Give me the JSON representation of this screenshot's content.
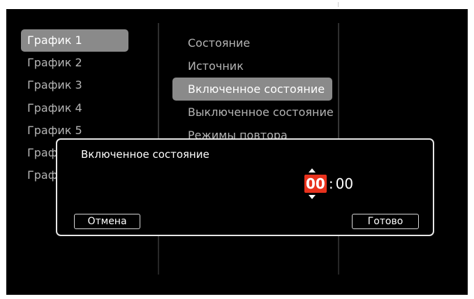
{
  "schedules": [
    {
      "label": "График 1",
      "selected": true
    },
    {
      "label": "График 2",
      "selected": false
    },
    {
      "label": "График 3",
      "selected": false
    },
    {
      "label": "График 4",
      "selected": false
    },
    {
      "label": "График 5",
      "selected": false
    },
    {
      "label": "Граф",
      "selected": false
    },
    {
      "label": "Граф",
      "selected": false
    }
  ],
  "settings": [
    {
      "label": "Состояние",
      "selected": false
    },
    {
      "label": "Источник",
      "selected": false
    },
    {
      "label": "Включенное состояние",
      "selected": true
    },
    {
      "label": "Выключенное состояние",
      "selected": false
    },
    {
      "label": "Режимы повтора",
      "selected": false
    }
  ],
  "dialog": {
    "title": "Включенное состояние",
    "hours": "00",
    "separator": ":",
    "minutes": "00",
    "cancel_label": "Отмена",
    "done_label": "Готово"
  },
  "colors": {
    "background": "#000000",
    "selection": "#8a8a8a",
    "accent": "#e8321d"
  }
}
